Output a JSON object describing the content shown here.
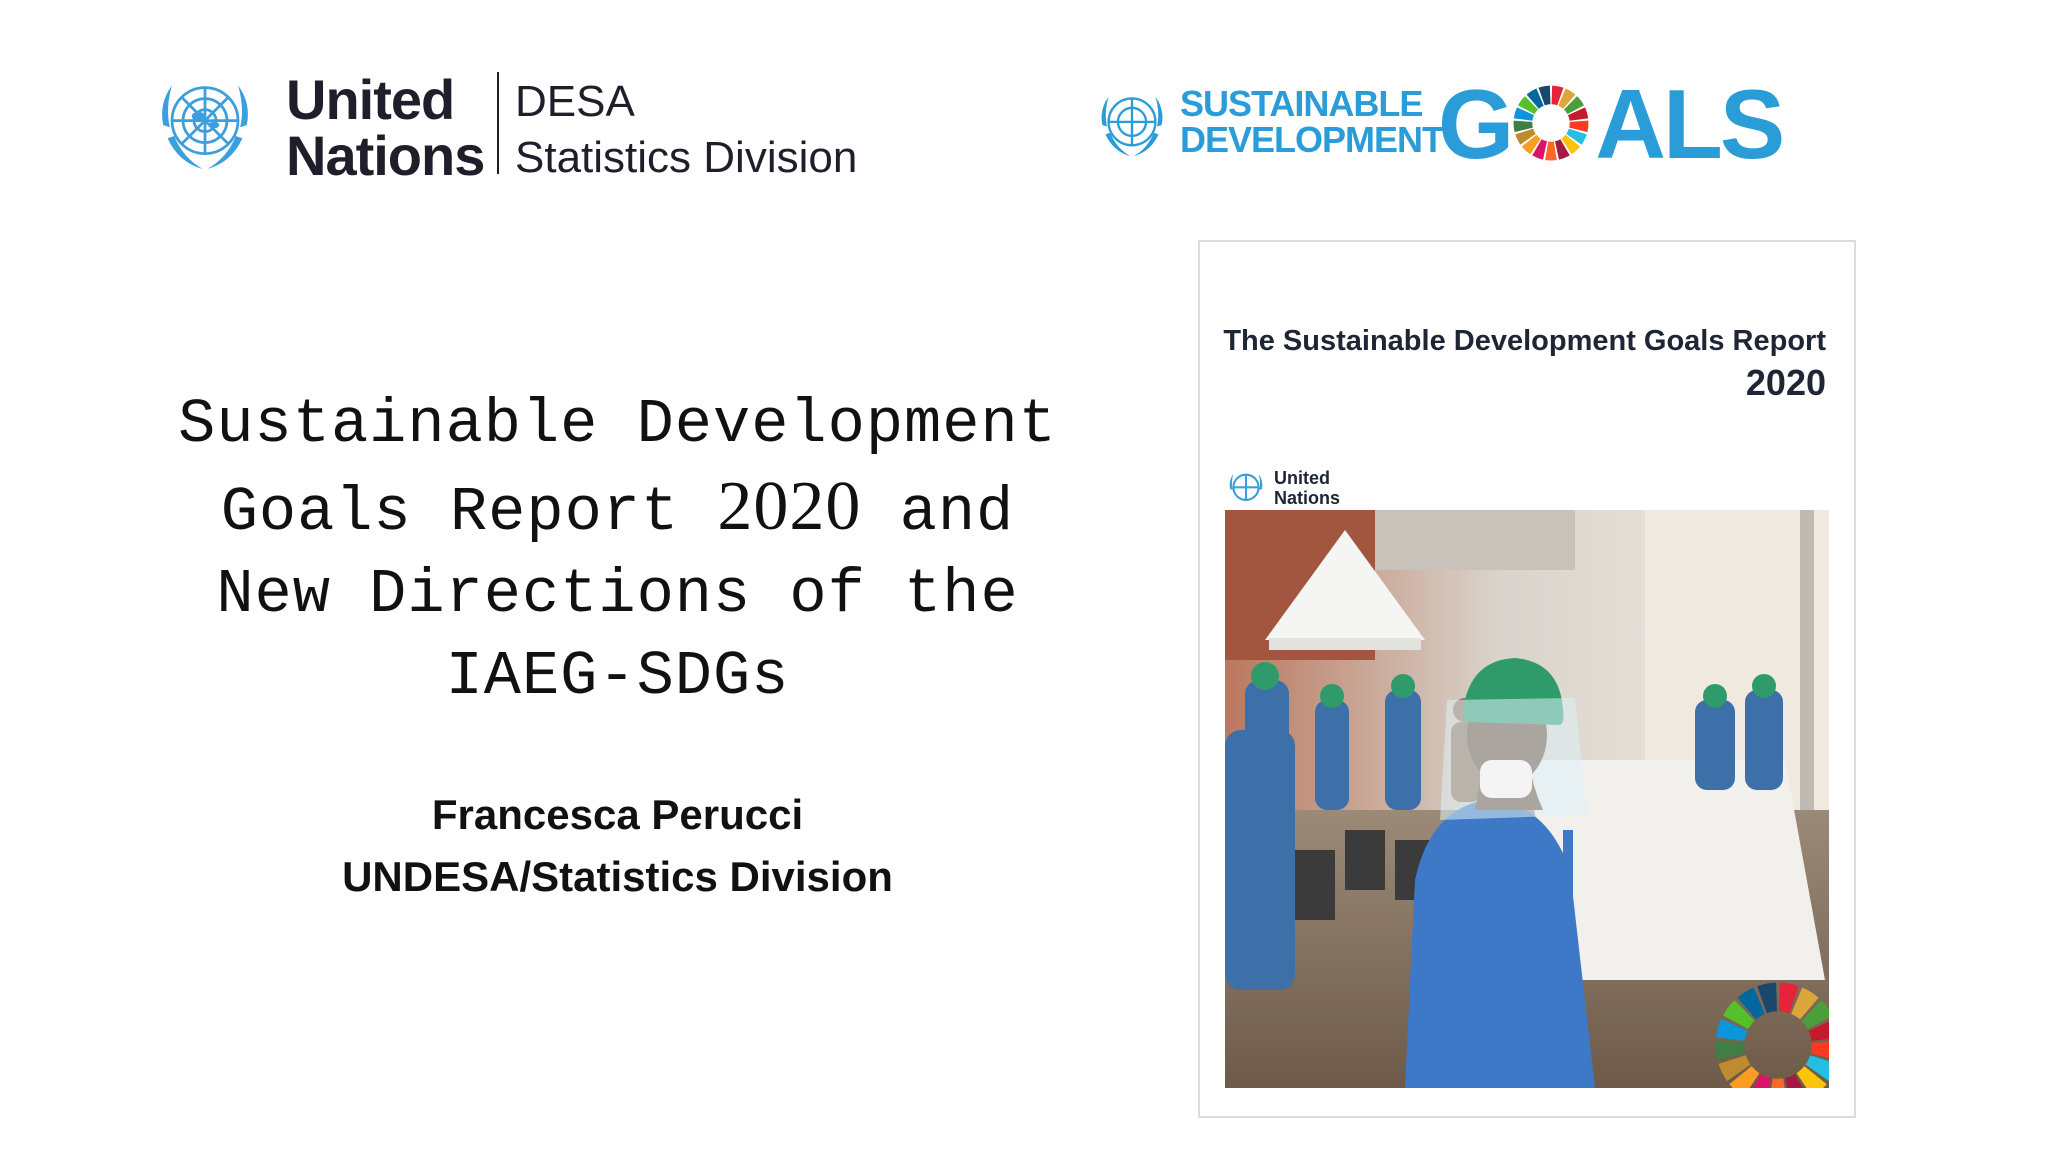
{
  "header": {
    "un_logo": {
      "icon": "un-emblem-icon",
      "name_lines": [
        "United",
        "Nations"
      ],
      "division_lines": [
        "DESA",
        "Statistics Division"
      ]
    },
    "sdg_logo": {
      "icon": "un-emblem-icon",
      "words": [
        "SUSTAINABLE",
        "DEVELOPMENT"
      ],
      "goals_prefix": "G",
      "goals_wheel_icon": "sdg-color-wheel-icon",
      "goals_suffix": "ALS"
    }
  },
  "title": {
    "line1": "Sustainable Development",
    "line2_before": "Goals Report",
    "line2_year": "2020",
    "line2_after": "and",
    "line3": "New Directions of the",
    "line4": "IAEG-SDGs"
  },
  "presenter": {
    "name": "Francesca Perucci",
    "affiliation": "UNDESA/Statistics Division"
  },
  "report_cover": {
    "title": "The Sustainable Development Goals Report",
    "year": "2020",
    "publisher_lines": [
      "United",
      "Nations"
    ],
    "photo_icon": "health-worker-photo",
    "wheel_icon": "sdg-color-wheel-icon"
  },
  "colors": {
    "sdg_blue": "#2a9dd8",
    "un_blue": "#3a9fdc",
    "text_dark": "#111111",
    "cover_text": "#1e2535"
  }
}
